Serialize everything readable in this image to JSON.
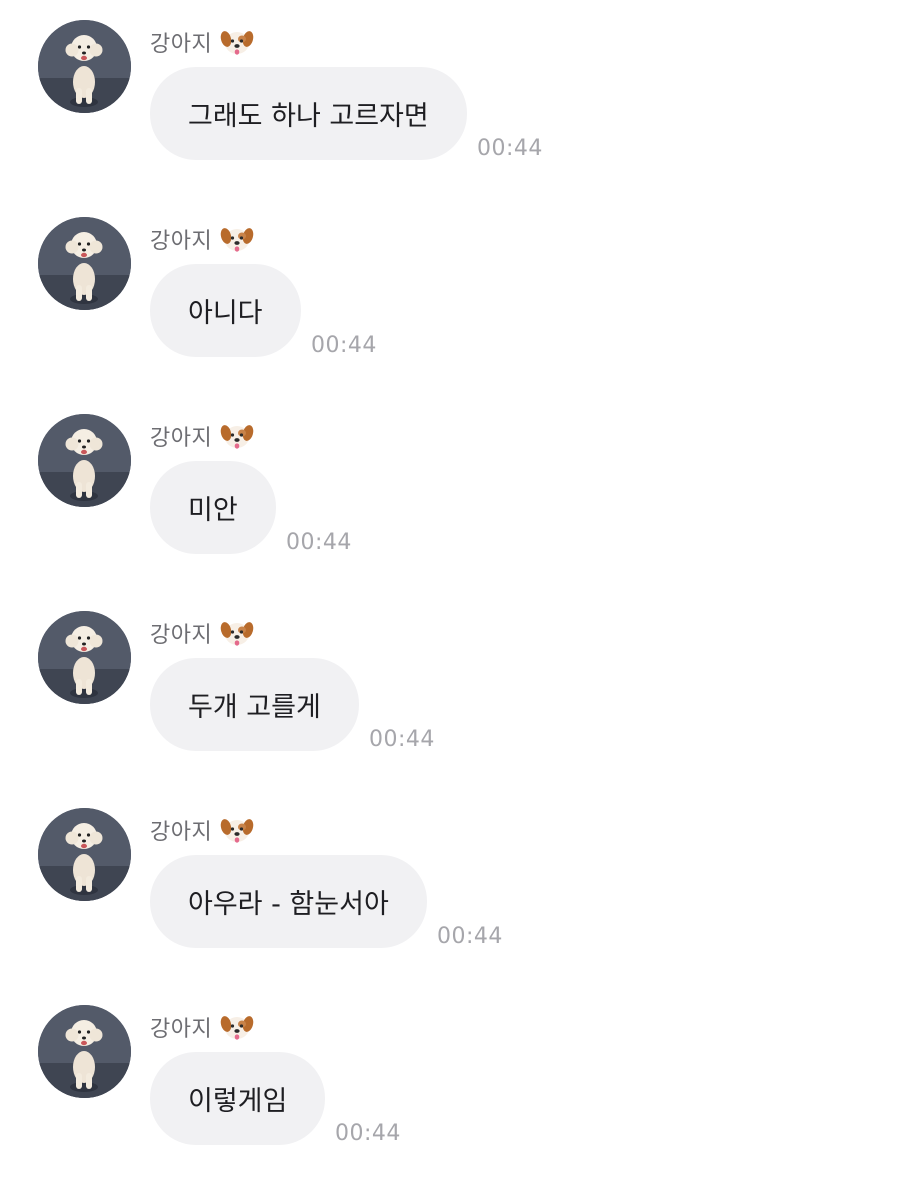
{
  "messages": [
    {
      "sender": "강아지",
      "sender_icon": "dog-face-icon",
      "text": "그래도 하나 고르자면",
      "time": "00:44"
    },
    {
      "sender": "강아지",
      "sender_icon": "dog-face-icon",
      "text": "아니다",
      "time": "00:44"
    },
    {
      "sender": "강아지",
      "sender_icon": "dog-face-icon",
      "text": "미안",
      "time": "00:44"
    },
    {
      "sender": "강아지",
      "sender_icon": "dog-face-icon",
      "text": "두개 고를게",
      "time": "00:44"
    },
    {
      "sender": "강아지",
      "sender_icon": "dog-face-icon",
      "text": "아우라 - 함눈서아",
      "time": "00:44"
    },
    {
      "sender": "강아지",
      "sender_icon": "dog-face-icon",
      "text": "이렇게임",
      "time": "00:44"
    }
  ],
  "colors": {
    "bubble": "#f1f1f3",
    "text": "#1e1e22",
    "sender": "#6d6d72",
    "time": "#a6a6ab"
  }
}
